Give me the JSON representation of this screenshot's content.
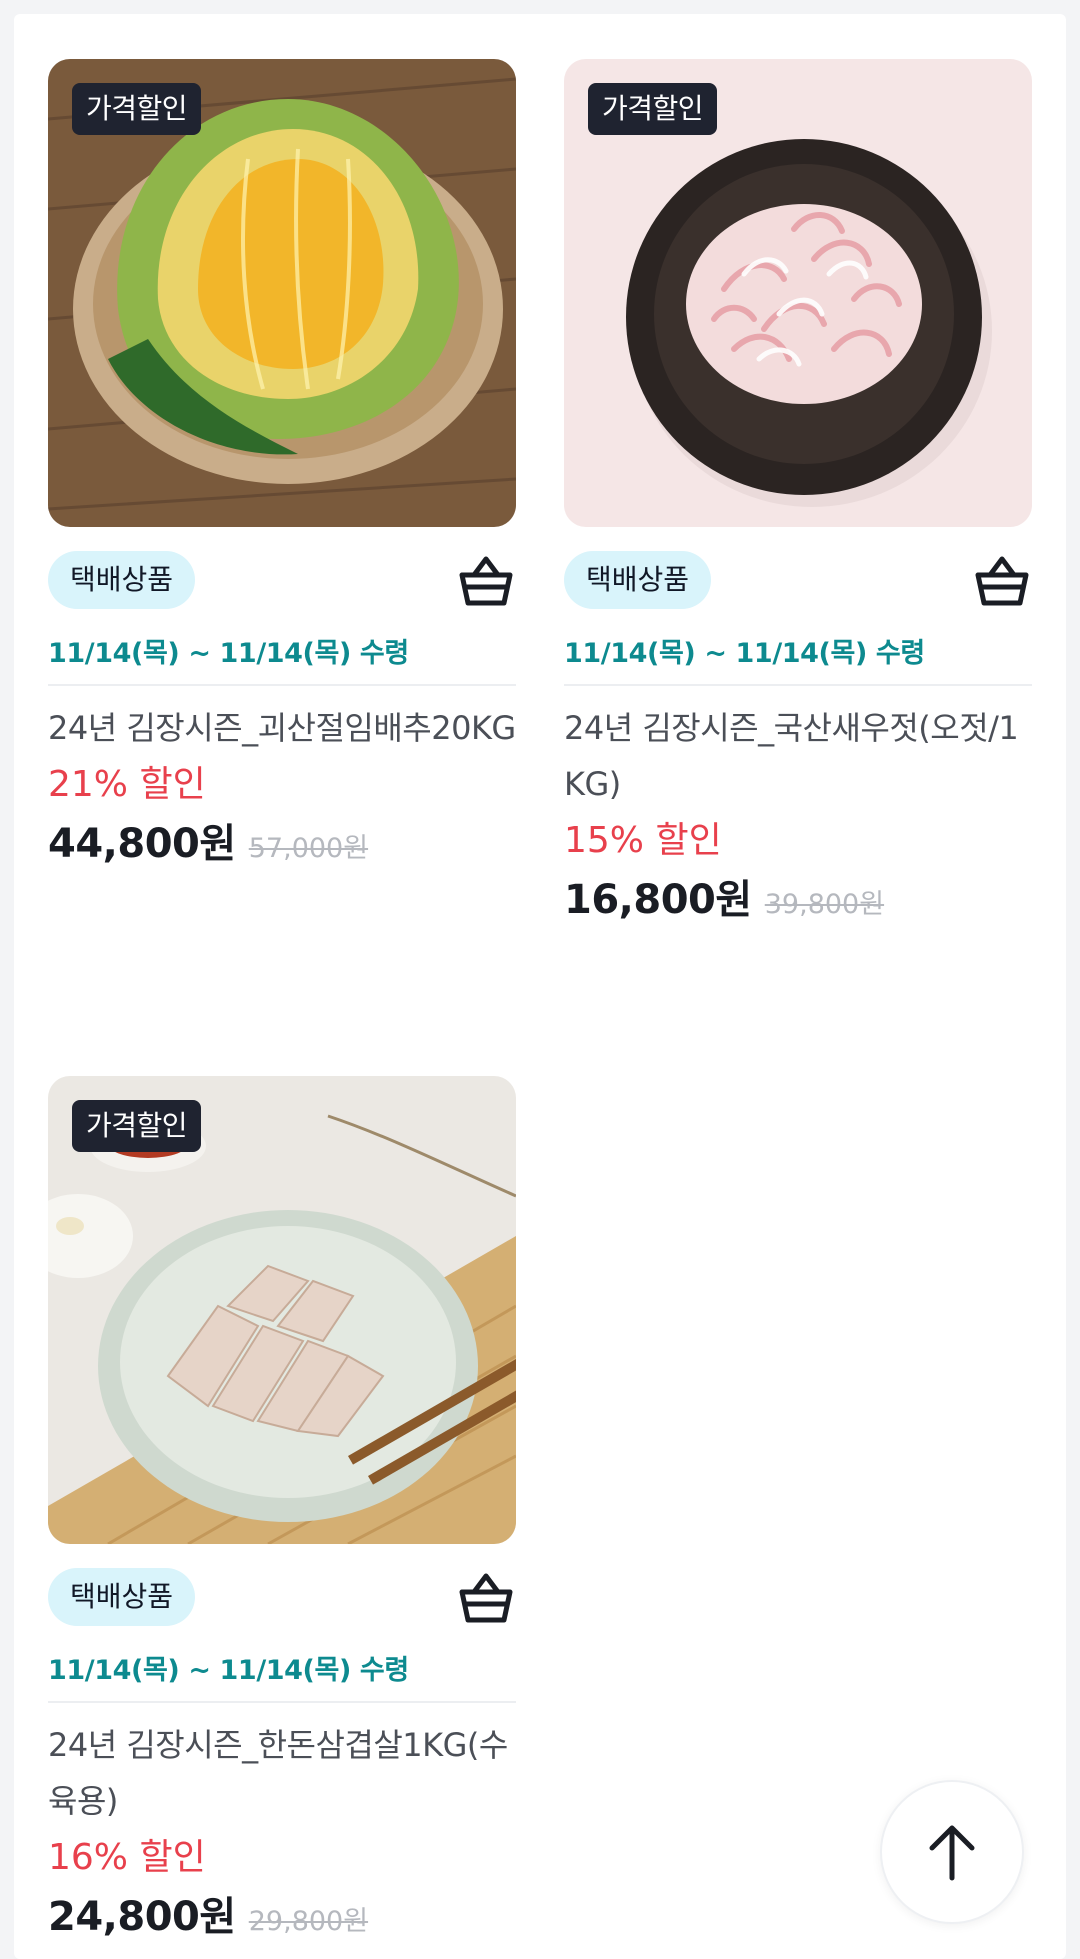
{
  "products": [
    {
      "badge": "가격할인",
      "delivery_tag": "택배상품",
      "pickup": "11/14(목) ~ 11/14(목) 수령",
      "name": "24년 김장시즌_괴산절임배추20KG",
      "discount": "21% 할인",
      "price": "44,800원",
      "original_price": "57,000원",
      "image": "salted-napa-cabbage-in-bowl"
    },
    {
      "badge": "가격할인",
      "delivery_tag": "택배상품",
      "pickup": "11/14(목) ~ 11/14(목) 수령",
      "name": "24년 김장시즌_국산새우젓(오젓/1KG)",
      "discount": "15% 할인",
      "price": "16,800원",
      "original_price": "39,800원",
      "image": "salted-shrimp-in-black-bowl"
    },
    {
      "badge": "가격할인",
      "delivery_tag": "택배상품",
      "pickup": "11/14(목) ~ 11/14(목) 수령",
      "name": "24년 김장시즌_한돈삼겹살1KG(수육용)",
      "discount": "16% 할인",
      "price": "24,800원",
      "original_price": "29,800원",
      "image": "boiled-pork-slices-on-plate"
    }
  ],
  "icons": {
    "cart": "shopping-basket-icon",
    "scroll_top": "arrow-up-icon"
  },
  "colors": {
    "pickup": "#0d8a8f",
    "discount": "#e8404c",
    "badge_bg": "#1f2330",
    "delivery_tag_bg": "#d9f4fb"
  }
}
